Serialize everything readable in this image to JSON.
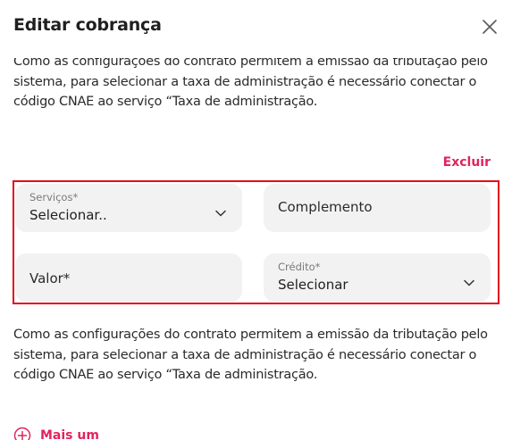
{
  "dialog": {
    "title": "Editar cobrança",
    "close_icon": "close-icon"
  },
  "info_text_top": "Como as configurações do contrato permitem a emissão da tributação pelo sistema, para selecionar a taxa de administração é necessário conectar o código CNAE ao serviço “Taxa de administração.",
  "item": {
    "delete_label": "Excluir",
    "servicos": {
      "label": "Serviços*",
      "value": "Selecionar.."
    },
    "complemento": {
      "placeholder": "Complemento"
    },
    "valor": {
      "placeholder": "Valor*"
    },
    "credito": {
      "label": "Crédito*",
      "value": "Selecionar"
    }
  },
  "info_text_bottom": "Como as configurações do contrato permitem a emissão da tributação pelo sistema, para selecionar a taxa de administração é necessário conectar o código CNAE ao serviço “Taxa de administração.",
  "add_more_label": "Mais um",
  "colors": {
    "accent": "#e0245e",
    "highlight_border": "#e10d1d",
    "field_bg": "#f2f2f2"
  }
}
